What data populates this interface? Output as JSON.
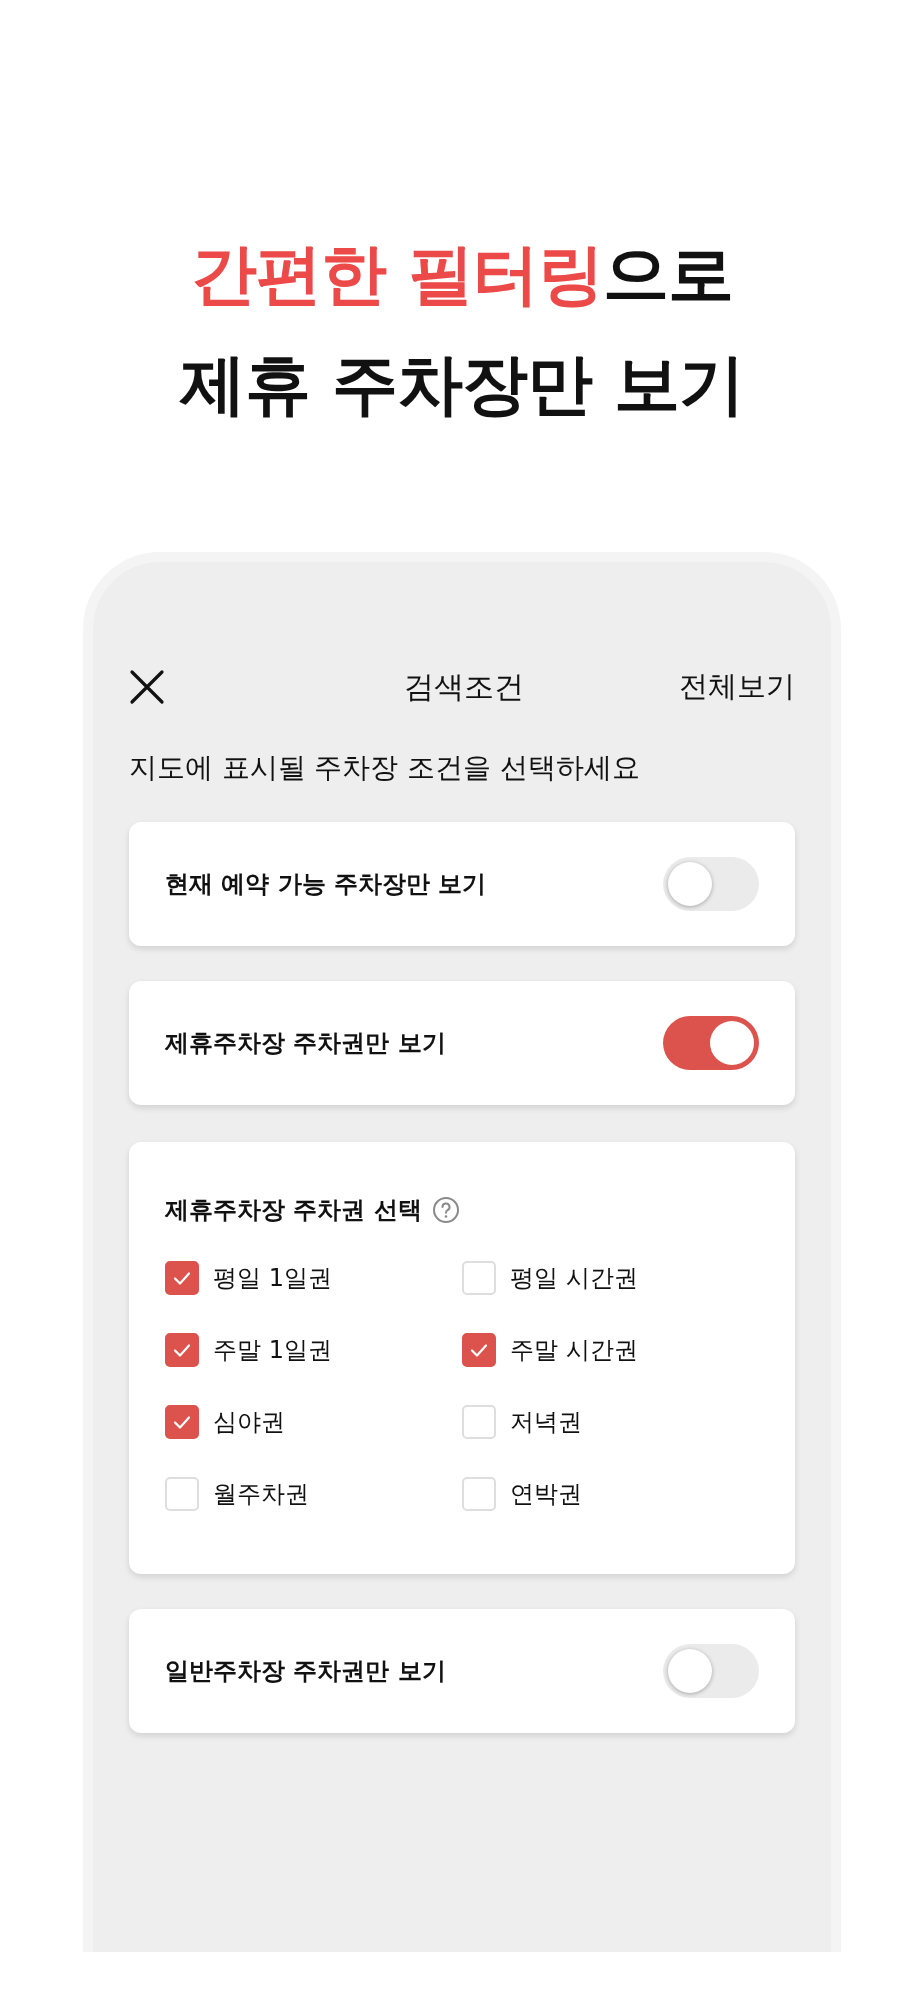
{
  "headline": [
    [
      {
        "text": "간편한 필터링",
        "highlighted": true
      },
      {
        "text": "으로",
        "highlighted": false
      }
    ],
    [
      {
        "text": "제휴 주차장만 보기",
        "highlighted": false
      }
    ]
  ],
  "screen": {
    "title": "검색조건",
    "action": "전체보기",
    "subtitle": "지도에 표시될 주차장 조건을 선택하세요",
    "cards": [
      {
        "kind": "toggle",
        "label": "현재 예약 가능 주차장만 보기",
        "on": false
      },
      {
        "kind": "toggle",
        "label": "제휴주차장 주차권만 보기",
        "on": true
      },
      {
        "kind": "checklist",
        "title": "제휴주차장 주차권 선택",
        "options": [
          {
            "label": "평일 1일권",
            "checked": true
          },
          {
            "label": "평일 시간권",
            "checked": false
          },
          {
            "label": "주말 1일권",
            "checked": true
          },
          {
            "label": "주말 시간권",
            "checked": true
          },
          {
            "label": "심야권",
            "checked": true
          },
          {
            "label": "저녁권",
            "checked": false
          },
          {
            "label": "월주차권",
            "checked": false
          },
          {
            "label": "연박권",
            "checked": false
          }
        ]
      },
      {
        "kind": "toggle",
        "label": "일반주차장 주차권만 보기",
        "on": false
      }
    ]
  }
}
